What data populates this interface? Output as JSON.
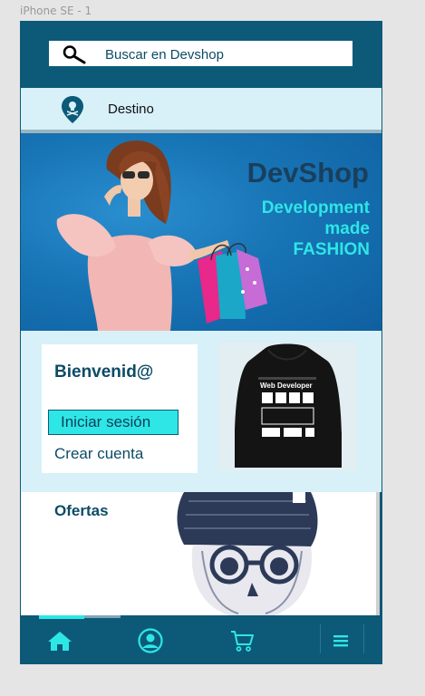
{
  "frame_label": "iPhone SE - 1",
  "search": {
    "placeholder": "Buscar en Devshop"
  },
  "destination": {
    "label": "Destino"
  },
  "hero": {
    "brand": "DevShop",
    "tagline": [
      "Development",
      "made",
      "FASHION"
    ]
  },
  "welcome": {
    "title": "Bienvenid@",
    "login_label": "Iniciar sesión",
    "create_account_label": "Crear cuenta"
  },
  "product": {
    "print_title": "Web Developer"
  },
  "offers": {
    "title": "Ofertas"
  },
  "nav": {
    "items": [
      {
        "name": "home",
        "icon": "home-icon"
      },
      {
        "name": "profile",
        "icon": "user-icon"
      },
      {
        "name": "cart",
        "icon": "cart-icon"
      },
      {
        "name": "menu",
        "icon": "menu-icon"
      }
    ]
  },
  "colors": {
    "primary": "#0c5a78",
    "accent": "#2ee6e6",
    "light": "#d8f0f8",
    "text_dark": "#0c4b66"
  }
}
